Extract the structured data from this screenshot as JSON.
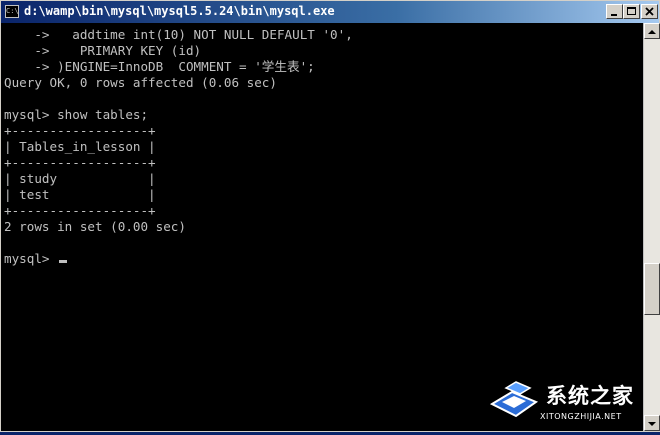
{
  "window": {
    "title": "d:\\wamp\\bin\\mysql\\mysql5.5.24\\bin\\mysql.exe",
    "app_icon": "C:\\",
    "controls": {
      "minimize": "minimize-icon",
      "maximize": "maximize-icon",
      "close": "close-icon"
    }
  },
  "console": {
    "lines": [
      "    ->   addtime int(10) NOT NULL DEFAULT '0',",
      "    ->    PRIMARY KEY (id)",
      "    -> )ENGINE=InnoDB  COMMENT = '学生表';",
      "Query OK, 0 rows affected (0.06 sec)",
      "",
      "mysql> show tables;",
      "+------------------+",
      "| Tables_in_lesson |",
      "+------------------+",
      "| study            |",
      "| test             |",
      "+------------------+",
      "2 rows in set (0.00 sec)",
      "",
      "mysql> "
    ],
    "prompt": "mysql> "
  },
  "watermark": {
    "name_cn": "系统之家",
    "site": "XITONGZHIJIA.NET"
  },
  "colors": {
    "console_bg": "#000000",
    "console_text": "#c0c0c0",
    "titlebar_start": "#0a246a",
    "titlebar_end": "#a6caf0"
  }
}
